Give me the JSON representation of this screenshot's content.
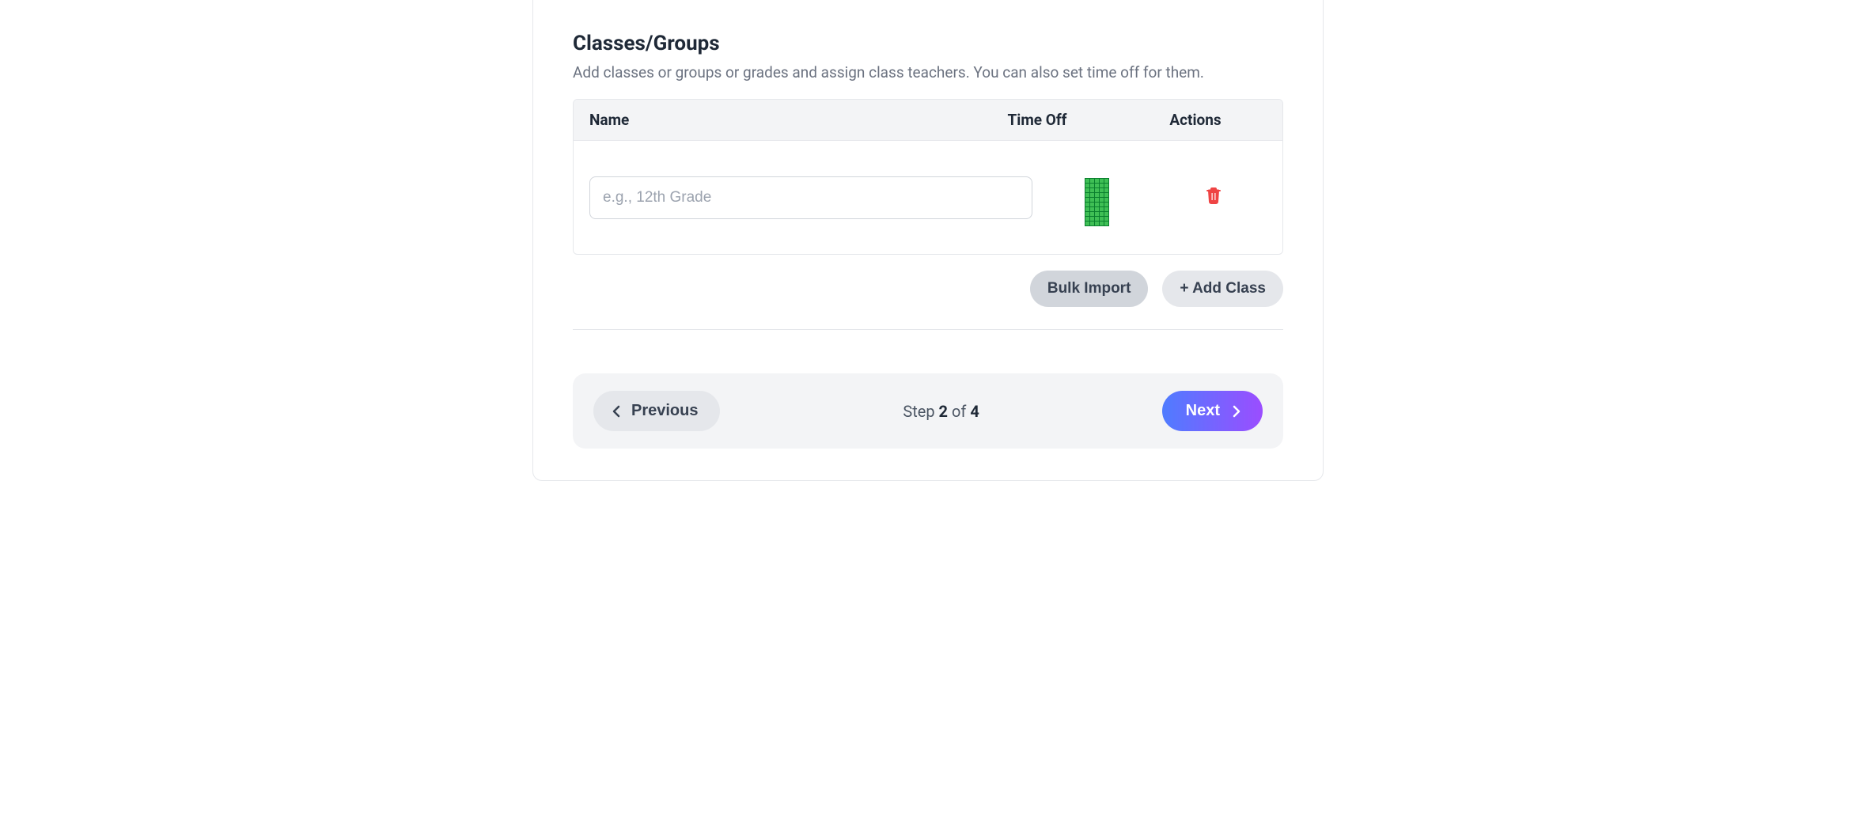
{
  "section": {
    "title": "Classes/Groups",
    "subtitle": "Add classes or groups or grades and assign class teachers. You can also set time off for them."
  },
  "table": {
    "headers": {
      "name": "Name",
      "timeoff": "Time Off",
      "actions": "Actions"
    },
    "rows": [
      {
        "name_value": "",
        "name_placeholder": "e.g., 12th Grade"
      }
    ]
  },
  "buttons": {
    "bulk_import": "Bulk Import",
    "add_class": "+ Add Class",
    "previous": "Previous",
    "next": "Next"
  },
  "stepper": {
    "prefix": "Step ",
    "current": "2",
    "separator": " of ",
    "total": "4"
  },
  "icons": {
    "trash_color": "#ef4444",
    "chev_prev_color": "#374151",
    "chev_next_color": "#ffffff"
  }
}
